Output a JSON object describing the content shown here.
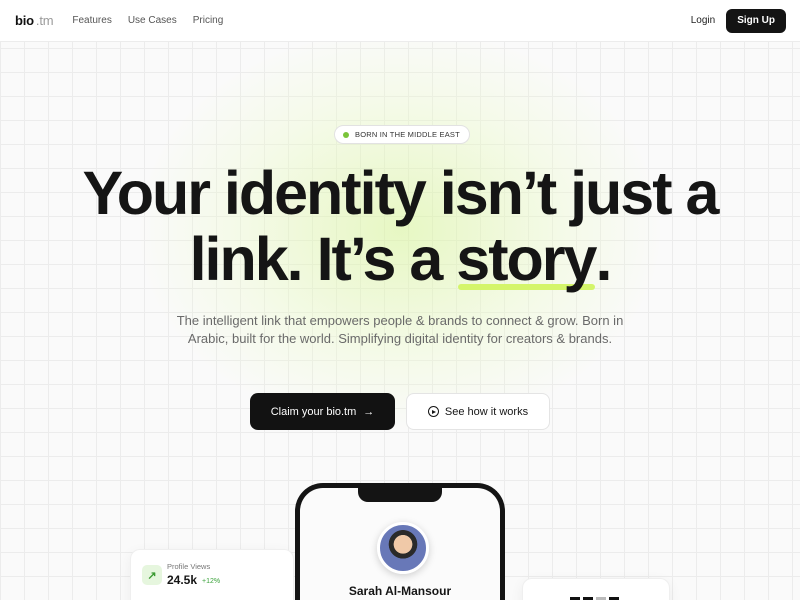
{
  "nav": {
    "logo_main": "bio",
    "logo_tld": ".tm",
    "links": [
      {
        "label": "Features"
      },
      {
        "label": "Use Cases"
      },
      {
        "label": "Pricing"
      }
    ],
    "login_label": "Login",
    "signup_label": "Sign Up"
  },
  "hero": {
    "badge": "BORN IN THE MIDDLE EAST",
    "headline_line1": "Your identity isn’t just a",
    "headline_line2_pre": "link. It’s a ",
    "headline_highlight": "story",
    "headline_line2_post": ".",
    "subtext": "The intelligent link that empowers people & brands to connect & grow. Born in Arabic, built for the world. Simplifying digital identity for creators & brands.",
    "cta_primary": "Claim your bio.tm",
    "cta_primary_arrow": "→",
    "cta_secondary": "See how it works"
  },
  "preview": {
    "profile_name": "Sarah Al-Mansour",
    "stat_label": "Profile Views",
    "stat_value": "24.5k",
    "stat_delta": "+12%",
    "stat_icon_glyph": "↗"
  },
  "colors": {
    "accent": "#d4f56a",
    "badge_dot": "#7ac43a",
    "primary_button": "#121212"
  }
}
